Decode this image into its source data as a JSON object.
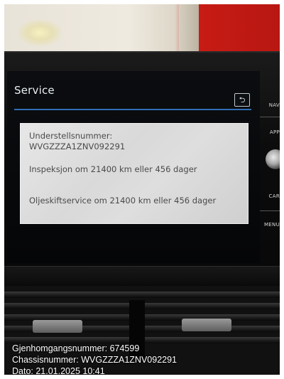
{
  "screen": {
    "title": "Service",
    "back_icon": "back-arrow-icon",
    "vehicle": {
      "label": "Understellsnummer:",
      "value": "WVGZZZA1ZNV092291"
    },
    "inspection": "Inspeksjon om 21400 km eller 456 dager",
    "oil_service": "Oljeskiftservice om 21400 km eller 456 dager"
  },
  "side_buttons": [
    "NAV",
    "APP",
    "CAR",
    "MENU"
  ],
  "overlay": {
    "line1": "Gjenhomgangsnummer: 674599",
    "line2": "Chassisnummer: WVGZZZA1ZNV092291",
    "line3": "Dato: 21.01.2025 10:41"
  },
  "colors": {
    "accent_rule": "#2f6db4",
    "panel_bg": "#dedede",
    "panel_text": "#4a4a4a",
    "background_wall_red": "#c81b15"
  }
}
